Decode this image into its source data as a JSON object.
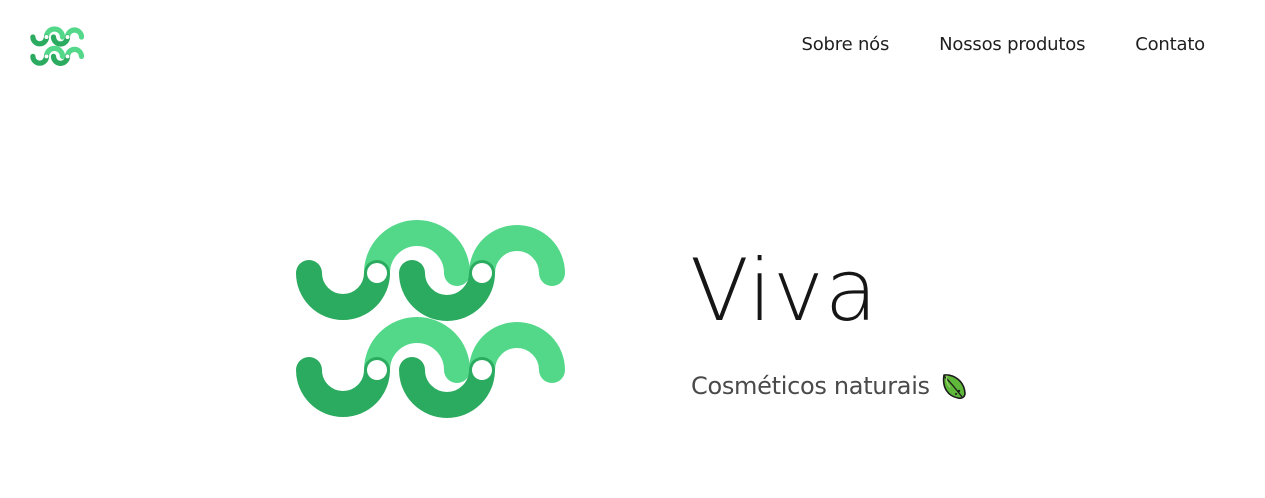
{
  "header": {
    "logo_icon": "wave-logo-icon",
    "nav": [
      {
        "label": "Sobre nós"
      },
      {
        "label": "Nossos produtos"
      },
      {
        "label": "Contato"
      }
    ]
  },
  "hero": {
    "logo_icon": "wave-logo-icon",
    "title": "Viva",
    "subtitle": "Cosméticos naturais",
    "subtitle_icon": "leaf-icon"
  },
  "colors": {
    "light_green": "#53d88a",
    "dark_green": "#2bab5f",
    "title": "#161616",
    "subtitle": "#4a4a4a",
    "nav_text": "#1f1f1f"
  }
}
